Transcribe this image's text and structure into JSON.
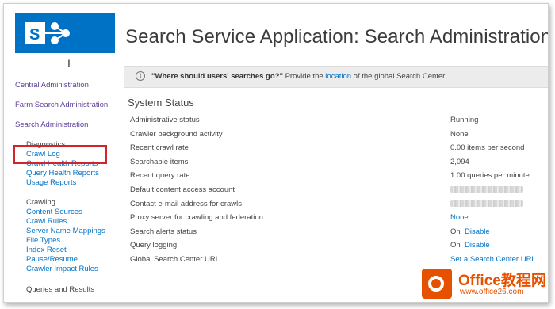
{
  "app": {
    "logo_letter": "S",
    "page_title": "Search Service Application: Search Administration"
  },
  "nav": {
    "top_links": [
      "Central Administration",
      "Farm Search Administration",
      "Search Administration"
    ],
    "diagnostics": {
      "heading": "Diagnostics",
      "items": [
        "Crawl Log",
        "Crawl Health Reports",
        "Query Health Reports",
        "Usage Reports"
      ]
    },
    "crawling": {
      "heading": "Crawling",
      "items": [
        "Content Sources",
        "Crawl Rules",
        "Server Name Mappings",
        "File Types",
        "Index Reset",
        "Pause/Resume",
        "Crawler Impact Rules"
      ]
    },
    "queries": {
      "heading": "Queries and Results"
    }
  },
  "infobar": {
    "icon": "info-icon",
    "bold_text": "\"Where should users' searches go?\"",
    "pre_link": " Provide the ",
    "link_text": "location",
    "post_link": " of the global Search Center"
  },
  "status": {
    "title": "System Status",
    "rows": [
      {
        "label": "Administrative status",
        "value": "Running"
      },
      {
        "label": "Crawler background activity",
        "value": "None"
      },
      {
        "label": "Recent crawl rate",
        "value": "0.00 items per second"
      },
      {
        "label": "Searchable items",
        "value": "2,094"
      },
      {
        "label": "Recent query rate",
        "value": "1.00 queries per minute"
      },
      {
        "label": "Default content access account",
        "value": ""
      },
      {
        "label": "Contact e-mail address for crawls",
        "value": ""
      },
      {
        "label": "Proxy server for crawling and federation",
        "value": "None"
      },
      {
        "label": "Search alerts status",
        "value": "On",
        "link": "Disable"
      },
      {
        "label": "Query logging",
        "value": "On",
        "link": "Disable"
      },
      {
        "label": "Global Search Center URL",
        "value": "Set a Search Center URL"
      }
    ]
  },
  "watermark": {
    "title": "Office教程网",
    "subtitle": "www.office26.com"
  },
  "colors": {
    "accent": "#0072c6",
    "nav_visited": "#5b3c99",
    "highlight": "#d0262b",
    "watermark": "#e65100"
  }
}
